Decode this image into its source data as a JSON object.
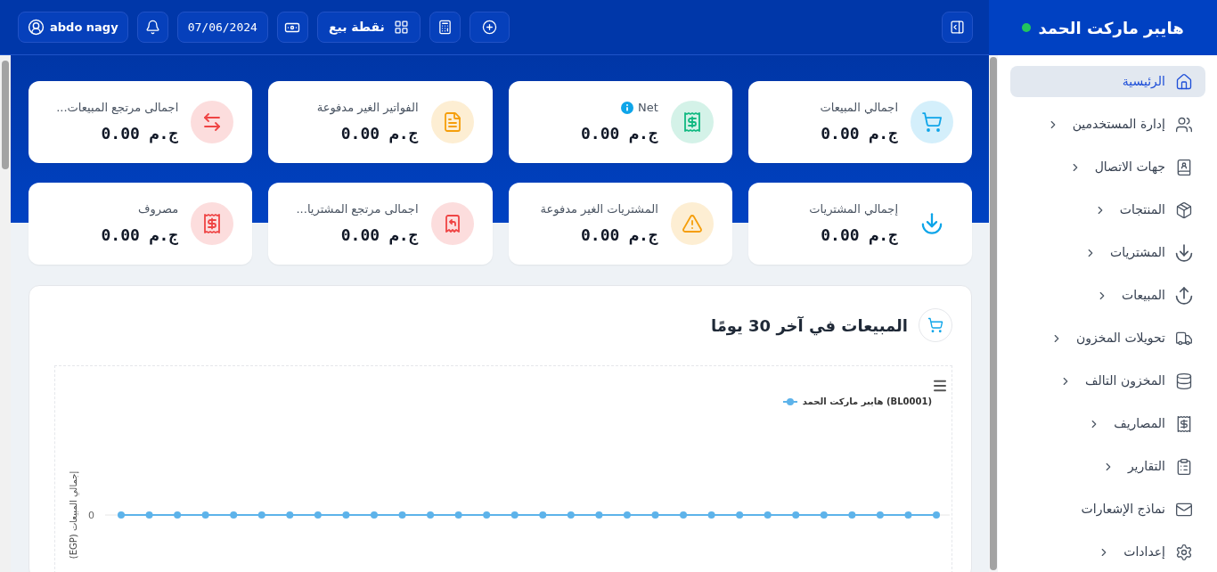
{
  "sidebar": {
    "title": "هايبر ماركت الحمد",
    "online": true,
    "items": [
      {
        "label": "الرئيسية",
        "selected": true,
        "expandable": false
      },
      {
        "label": "إدارة المستخدمين",
        "selected": false,
        "expandable": true
      },
      {
        "label": "جهات الاتصال",
        "selected": false,
        "expandable": true
      },
      {
        "label": "المنتجات",
        "selected": false,
        "expandable": true
      },
      {
        "label": "المشتريات",
        "selected": false,
        "expandable": true
      },
      {
        "label": "المبيعات",
        "selected": false,
        "expandable": true
      },
      {
        "label": "تحويلات المخزون",
        "selected": false,
        "expandable": true
      },
      {
        "label": "المخزون التالف",
        "selected": false,
        "expandable": true
      },
      {
        "label": "المصاريف",
        "selected": false,
        "expandable": true
      },
      {
        "label": "التقارير",
        "selected": false,
        "expandable": true
      },
      {
        "label": "نماذج الإشعارات",
        "selected": false,
        "expandable": false
      },
      {
        "label": "إعدادات",
        "selected": false,
        "expandable": true
      }
    ]
  },
  "topbar": {
    "user": "abdo nagy",
    "date": "07/06/2024",
    "pos": "نقطة بيع"
  },
  "cards": [
    {
      "label": "اجمالي المبيعات",
      "value": "ج.م 0.00",
      "color": "#0ea5e9",
      "backdrop": true,
      "info": false
    },
    {
      "label": "Net",
      "value": "ج.م 0.00",
      "color": "#10b981",
      "backdrop": true,
      "info": true
    },
    {
      "label": "الفواتير الغير مدفوعة",
      "value": "ج.م 0.00",
      "color": "#f59e0b",
      "backdrop": true,
      "info": false
    },
    {
      "label": "اجمالى مرتجع المبيعات...",
      "value": "ج.م 0.00",
      "color": "#ef4444",
      "backdrop": true,
      "info": false
    },
    {
      "label": "إجمالي المشتريات",
      "value": "ج.م 0.00",
      "color": "#0ea5e9",
      "backdrop": false,
      "info": false
    },
    {
      "label": "المشتريات الغير مدفوعة",
      "value": "ج.م 0.00",
      "color": "#f59e0b",
      "backdrop": true,
      "info": false
    },
    {
      "label": "اجمالى مرتجع المشتريا...",
      "value": "ج.م 0.00",
      "color": "#ef4444",
      "backdrop": true,
      "info": false
    },
    {
      "label": "مصروف",
      "value": "ج.م 0.00",
      "color": "#ef4444",
      "backdrop": true,
      "info": false
    }
  ],
  "sales_chart": {
    "title": "المبيعات في آخر 30 يومًا",
    "legend": "(BL0001) هايبر ماركت الحمد",
    "y_axis_label": "إجمالي المبيعات (EGP)",
    "y_tick": "0"
  }
}
